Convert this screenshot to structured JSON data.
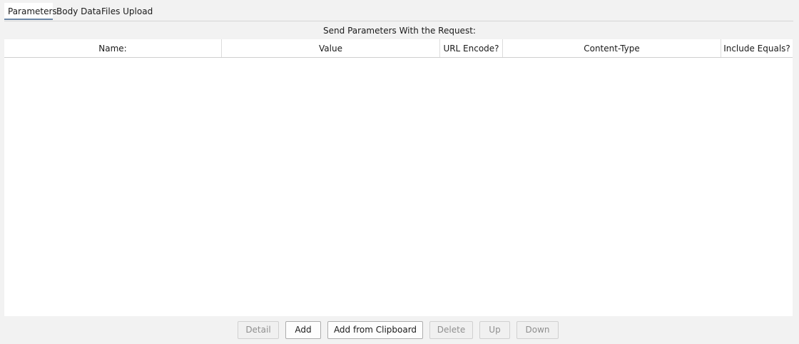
{
  "tabs": [
    {
      "label": "Parameters",
      "active": true
    },
    {
      "label": "Body Data",
      "active": false
    },
    {
      "label": "Files Upload",
      "active": false
    }
  ],
  "section_title": "Send Parameters With the Request:",
  "table": {
    "columns": [
      "Name:",
      "Value",
      "URL Encode?",
      "Content-Type",
      "Include Equals?"
    ],
    "rows": []
  },
  "buttons": {
    "detail": {
      "label": "Detail",
      "enabled": false
    },
    "add": {
      "label": "Add",
      "enabled": true
    },
    "add_from_clipboard": {
      "label": "Add from Clipboard",
      "enabled": true
    },
    "delete": {
      "label": "Delete",
      "enabled": false
    },
    "up": {
      "label": "Up",
      "enabled": false
    },
    "down": {
      "label": "Down",
      "enabled": false
    }
  },
  "colors": {
    "background": "#f2f2f2",
    "table_background": "#ffffff",
    "active_tab_underline": "#6b86a6",
    "disabled_text": "#8f8f8f"
  }
}
